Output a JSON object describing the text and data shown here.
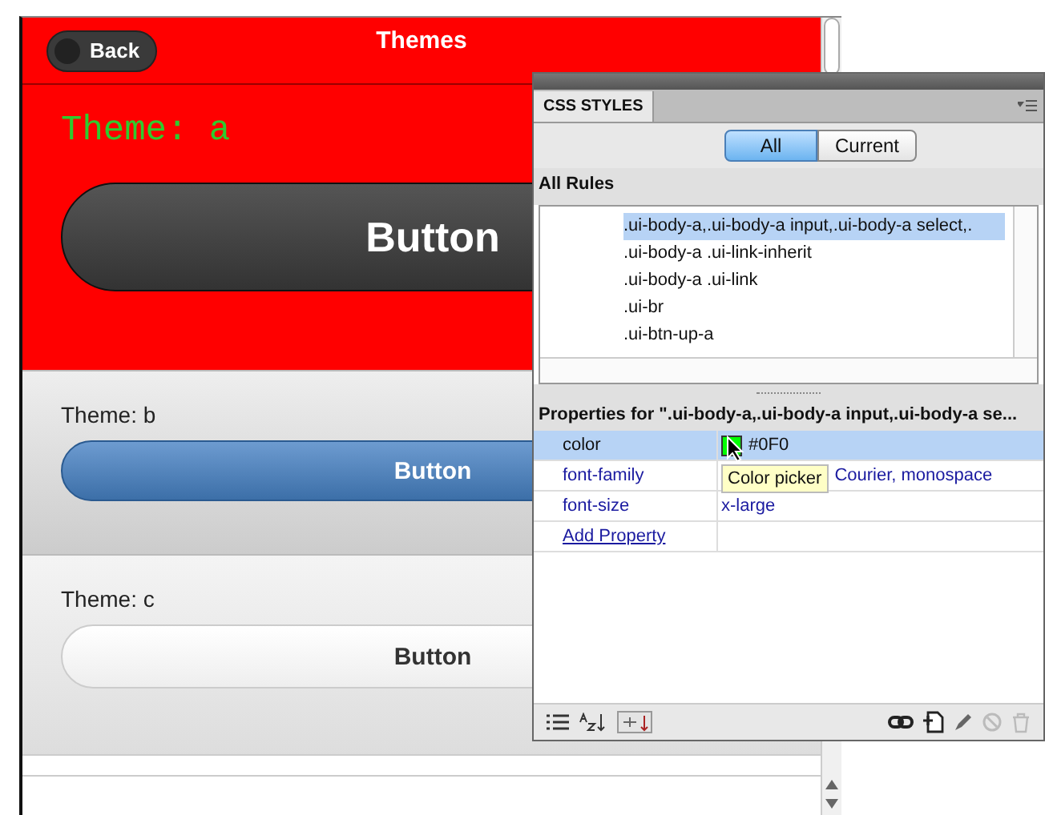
{
  "preview": {
    "header": {
      "back": "Back",
      "title": "Themes"
    },
    "sections": [
      {
        "kind": "a",
        "label": "Theme: a",
        "button": "Button"
      },
      {
        "kind": "b",
        "label": "Theme: b",
        "button": "Button"
      },
      {
        "kind": "c",
        "label": "Theme: c",
        "button": "Button"
      }
    ]
  },
  "panel": {
    "tab": "CSS STYLES",
    "modes": [
      {
        "label": "All",
        "selected": true
      },
      {
        "label": "Current",
        "selected": false
      }
    ],
    "rules_heading": "All Rules",
    "rules": [
      {
        "text": ".ui-body-a,.ui-body-a input,.ui-body-a select,.",
        "selected": true
      },
      {
        "text": ".ui-body-a .ui-link-inherit",
        "selected": false
      },
      {
        "text": ".ui-body-a .ui-link",
        "selected": false
      },
      {
        "text": ".ui-br",
        "selected": false
      },
      {
        "text": ".ui-btn-up-a",
        "selected": false
      }
    ],
    "properties_heading": "Properties for \".ui-body-a,.ui-body-a input,.ui-body-a se...",
    "properties": [
      {
        "name": "color",
        "kind": "color",
        "value": "#0F0",
        "selected": true
      },
      {
        "name": "font-family",
        "kind": "text",
        "value": "Courier, monospace",
        "selected": false
      },
      {
        "name": "font-size",
        "kind": "text",
        "value": "x-large",
        "selected": false
      }
    ],
    "add_property": "Add Property",
    "tooltip": "Color picker"
  }
}
